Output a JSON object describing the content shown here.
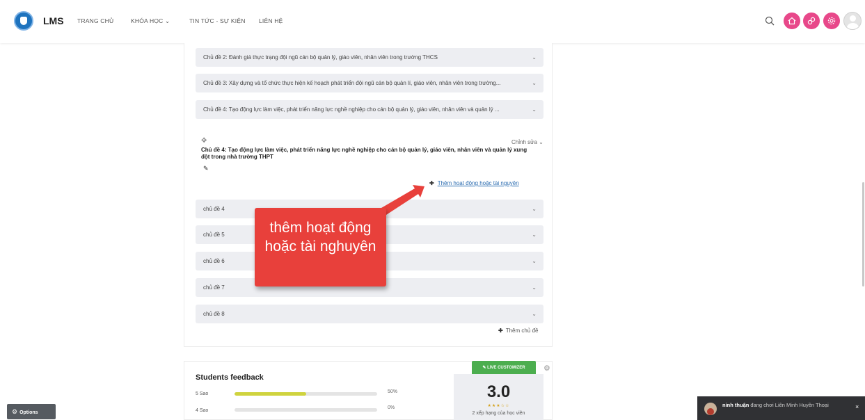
{
  "header": {
    "brand": "LMS",
    "nav": [
      "TRANG CHỦ",
      "KHÓA HỌC ⌄",
      "TIN TỨC - SỰ KIỆN",
      "LIÊN HỆ"
    ],
    "accent_color": "#e8488a"
  },
  "sections": [
    "Chủ đề 2: Đánh giá thực trạng đội ngũ cán bộ quản lý, giáo viên, nhân viên trong trường THCS",
    "Chủ đề 3: Xây dựng và tổ chức thực hiện kế hoạch phát triển đội ngũ cán bộ quản lí, giáo viên, nhân viên trong trường...",
    "Chủ đề 4: Tạo động lực làm việc, phát triển năng lực nghề nghiệp cho cán bộ quản lý, giáo viên, nhân viên và quản lý ..."
  ],
  "expanded": {
    "edit_label": "Chỉnh sửa ⌄",
    "title": "Chủ đề 4: Tạo động lực làm việc, phát triển năng lực nghề nghiệp cho cán bộ quản lý, giáo viên, nhân viên và quản lý xung đột trong nhà trường THPT",
    "add_activity": "Thêm hoạt động hoặc tài nguyên"
  },
  "topics": [
    "chủ đề 4",
    "chủ đề 5",
    "chủ đề 6",
    "chủ đề 7",
    "chủ đề 8"
  ],
  "add_topic": "Thêm chủ đề",
  "callout": {
    "text": "thêm hoạt động hoặc tài nghuyên",
    "color": "#e8403b"
  },
  "feedback": {
    "live_button": "LIVE CUSTOMIZER",
    "title": "Students feedback",
    "ratings": [
      {
        "label": "5 Sao",
        "percent": 50,
        "percent_text": "50%"
      },
      {
        "label": "4 Sao",
        "percent": 0,
        "percent_text": "0%"
      }
    ],
    "score": "3.0",
    "stars": "★★★☆☆",
    "rating_count": "2 xếp hạng của học viên"
  },
  "options_label": "Options",
  "notification": {
    "name": "ninh thuận",
    "message": " đang chơi Liên Minh Huyền Thoại",
    "close": "×"
  }
}
